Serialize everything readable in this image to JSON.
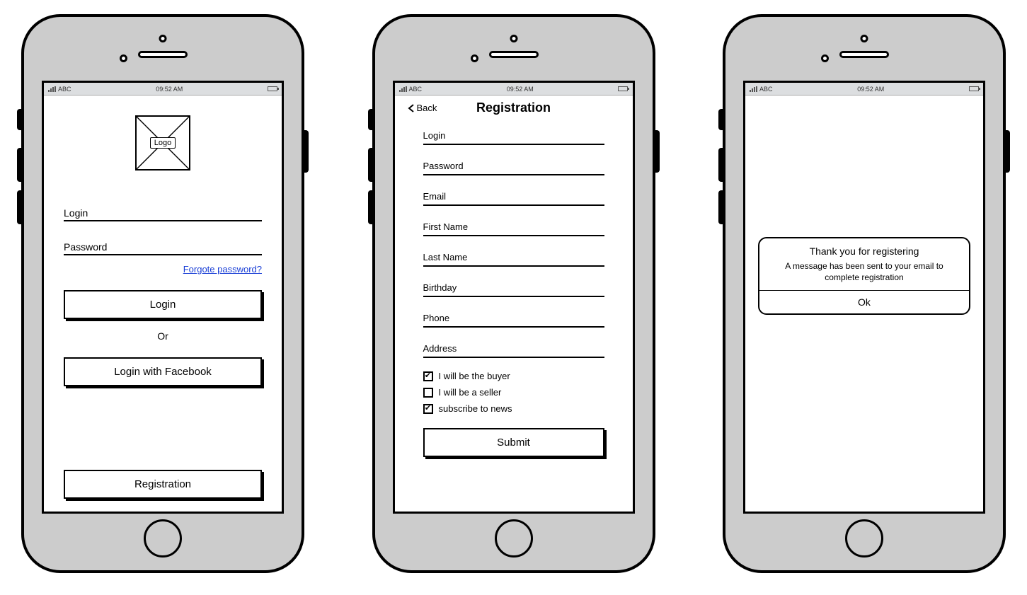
{
  "status": {
    "carrier": "ABC",
    "time": "09:52 AM"
  },
  "screen1": {
    "logo_label": "Logo",
    "login_label": "Login",
    "password_label": "Password",
    "forgot": "Forgote password?",
    "login_btn": "Login",
    "or": "Or",
    "fb_btn": "Login with Facebook",
    "register_btn": "Registration"
  },
  "screen2": {
    "back": "Back",
    "title": "Registration",
    "fields": {
      "login": "Login",
      "password": "Password",
      "email": "Email",
      "first_name": "First Name",
      "last_name": "Last Name",
      "birthday": "Birthday",
      "phone": "Phone",
      "address": "Address"
    },
    "checks": {
      "buyer": {
        "label": "I will be the buyer",
        "checked": true
      },
      "seller": {
        "label": "I will be a seller",
        "checked": false
      },
      "news": {
        "label": "subscribe to news",
        "checked": true
      }
    },
    "submit": "Submit"
  },
  "screen3": {
    "title": "Thank you for registering",
    "message": "A message has been sent to your email to complete registration",
    "ok": "Ok"
  }
}
